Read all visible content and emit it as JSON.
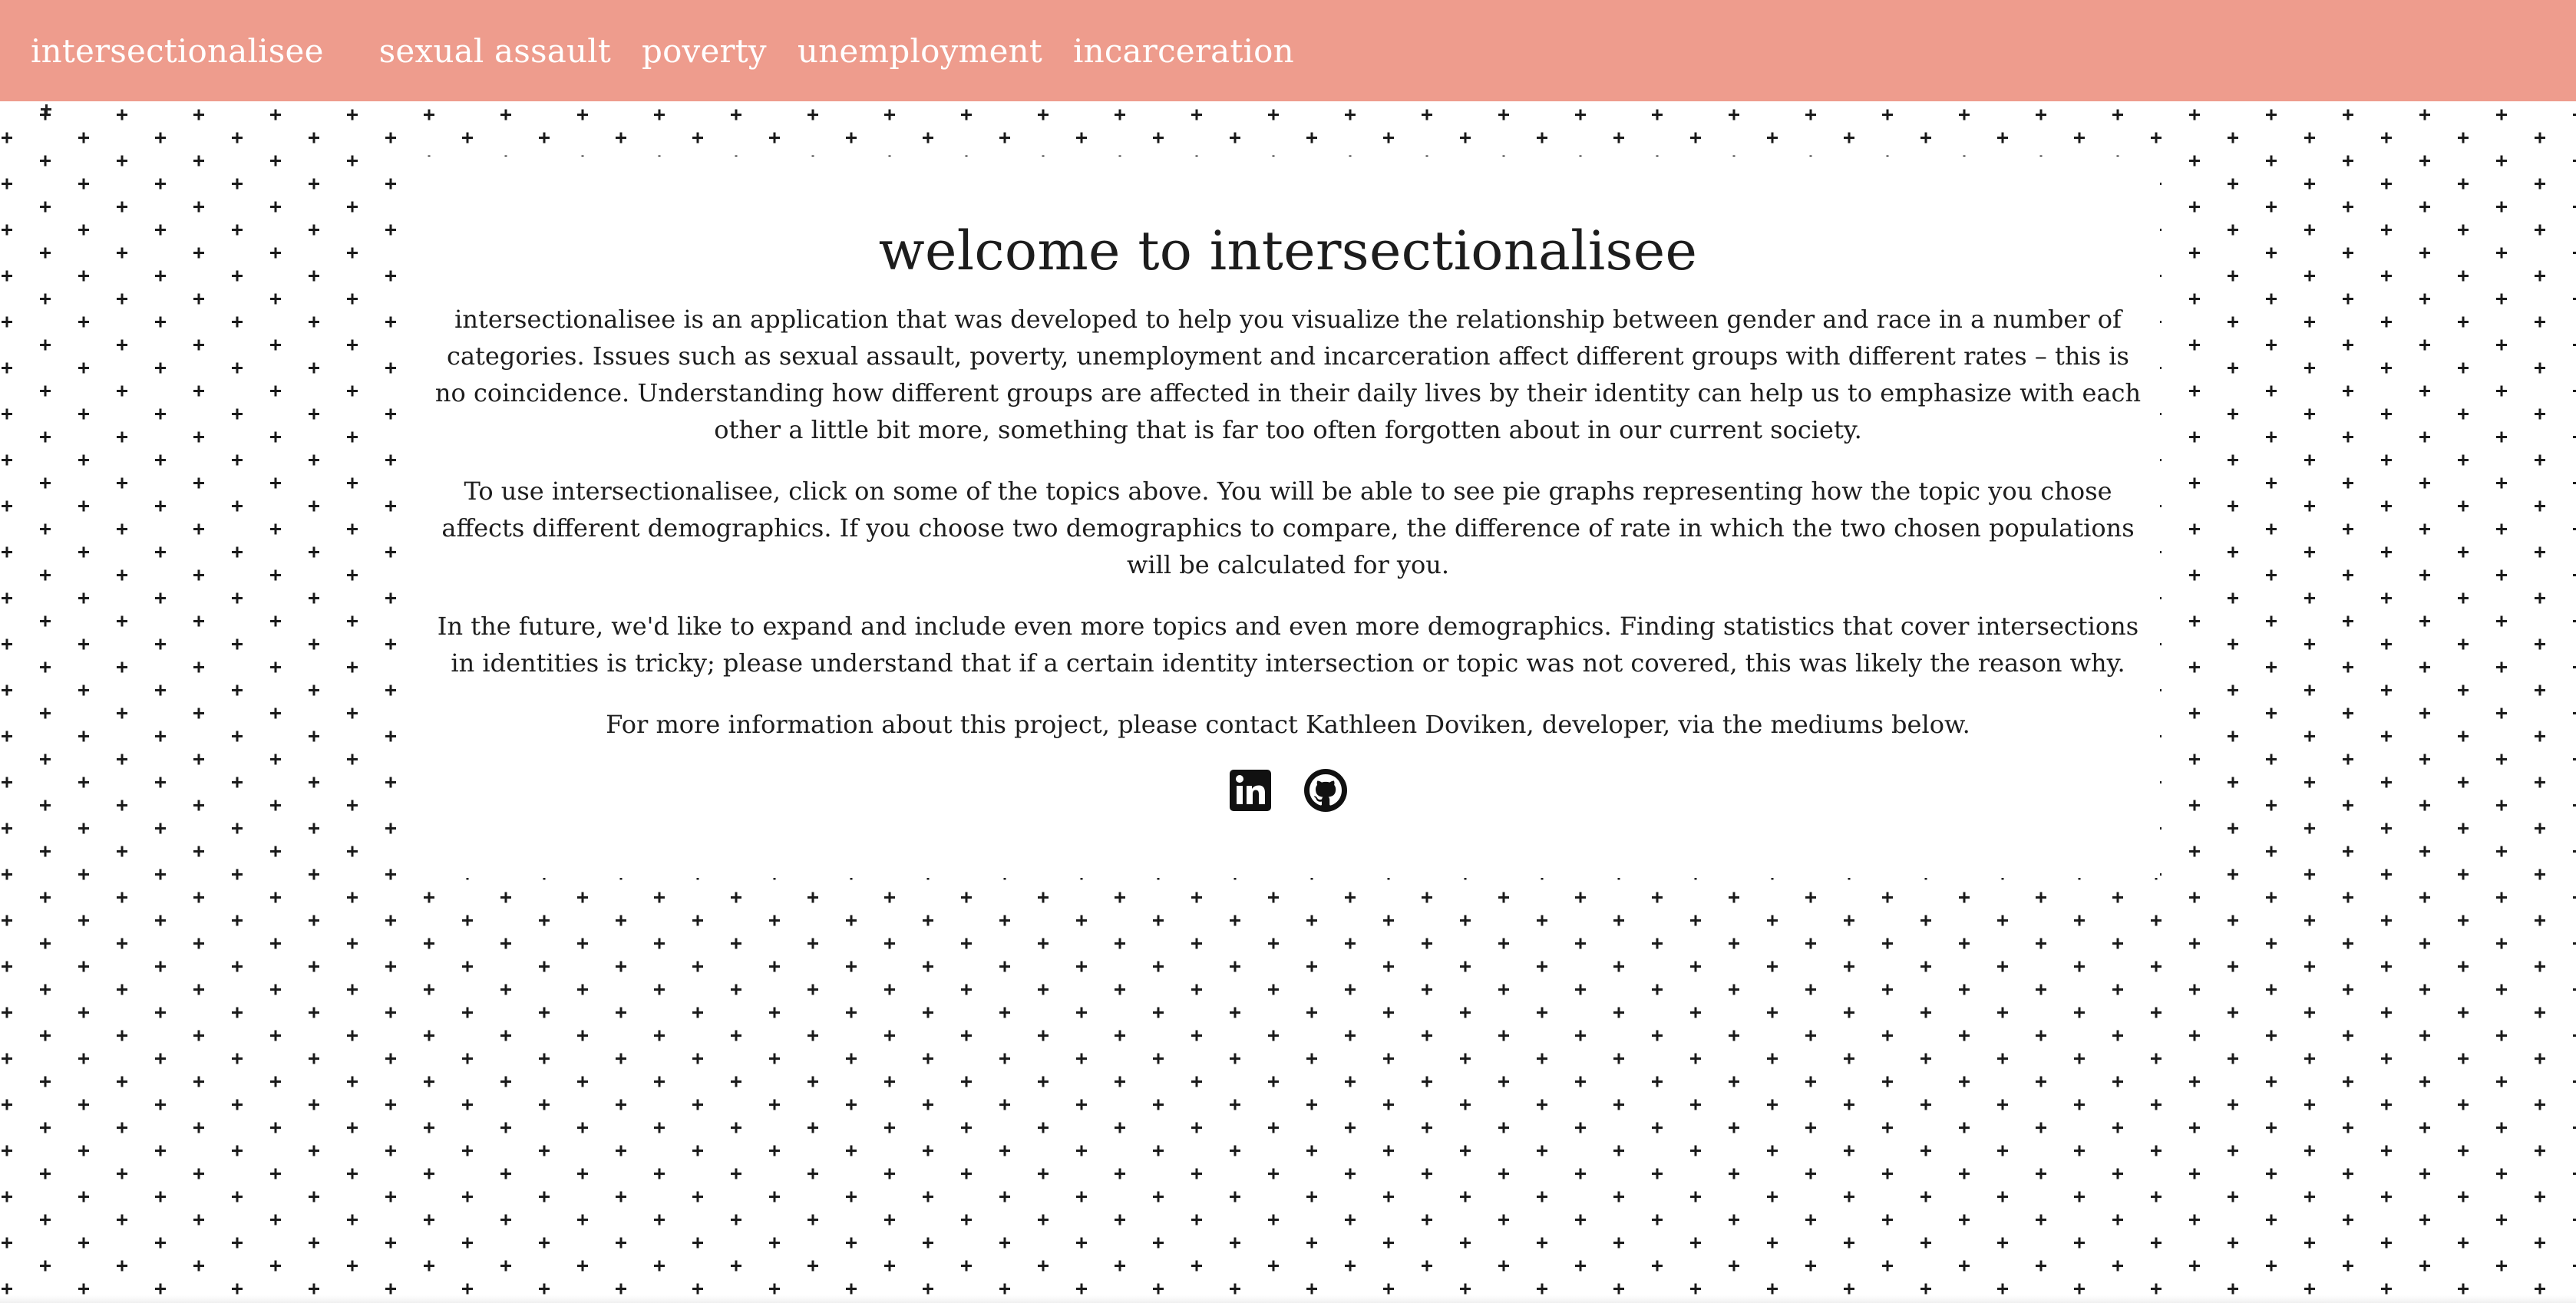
{
  "nav": {
    "brand": "intersectionalisee",
    "links": [
      "sexual assault",
      "poverty",
      "unemployment",
      "incarceration"
    ]
  },
  "main": {
    "title": "welcome to intersectionalisee",
    "paragraphs": [
      "intersectionalisee is an application that was developed to help you visualize the relationship between gender and race in a number of categories. Issues such as sexual assault, poverty, unemployment and incarceration affect different groups with different rates – this is no coincidence. Understanding how different groups are affected in their daily lives by their identity can help us to emphasize with each other a little bit more, something that is far too often forgotten about in our current society.",
      "To use intersectionalisee, click on some of the topics above. You will be able to see pie graphs representing how the topic you chose affects different demographics. If you choose two demographics to compare, the difference of rate in which the two chosen populations will be calculated for you.",
      "In the future, we'd like to expand and include even more topics and even more demographics. Finding statistics that cover intersections in identities is tricky; please understand that if a certain identity intersection or topic was not covered, this was likely the reason why.",
      "For more information about this project, please contact Kathleen Doviken, developer, via the mediums below."
    ],
    "icons": [
      "linkedin-icon",
      "github-icon"
    ]
  },
  "colors": {
    "header": "#ee9c8d",
    "text": "#1d1d1d",
    "pattern": "#1a1a1a"
  }
}
